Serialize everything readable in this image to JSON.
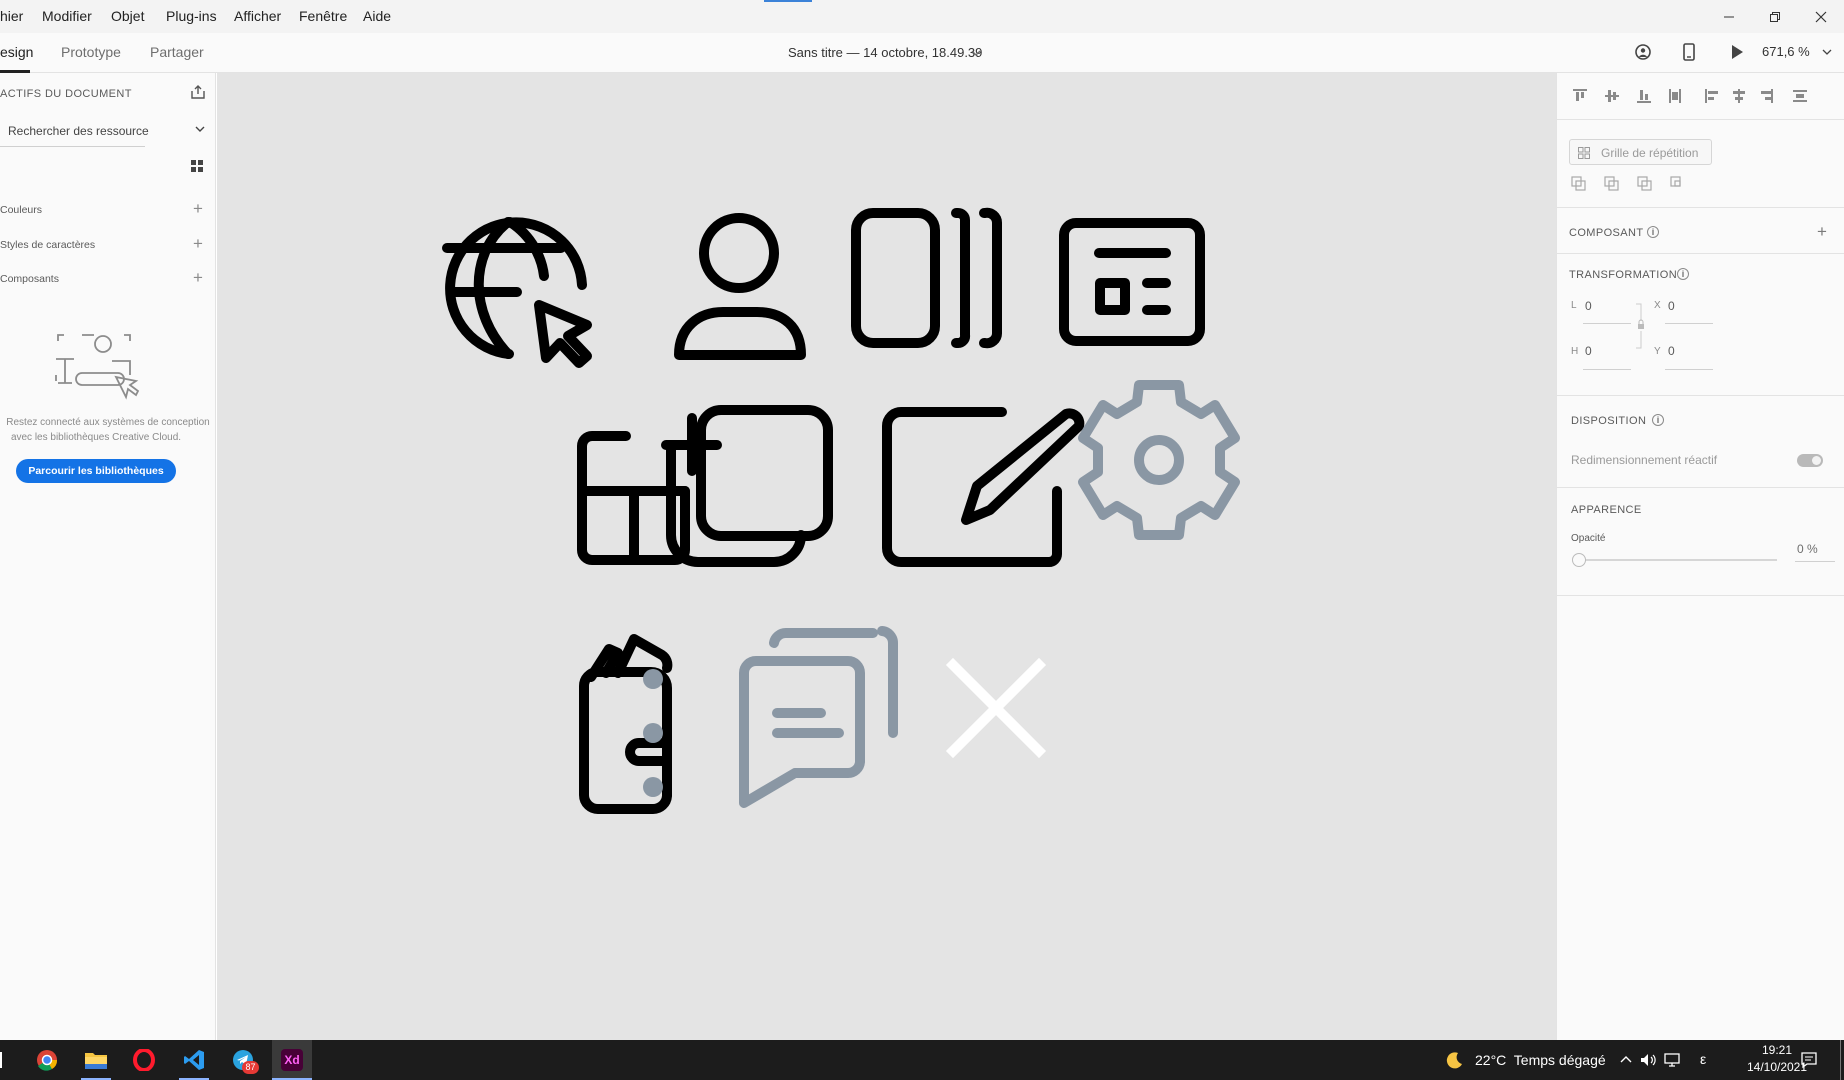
{
  "menubar": {
    "items": [
      "hier",
      "Modifier",
      "Objet",
      "Plug-ins",
      "Afficher",
      "Fenêtre",
      "Aide"
    ]
  },
  "toolbar": {
    "tabs": [
      "esign",
      "Prototype",
      "Partager"
    ],
    "document_title": "Sans titre — 14 octobre, 18.49.39",
    "zoom": "671,6 %"
  },
  "left_panel": {
    "header": "ACTIFS DU DOCUMENT",
    "search_value": "Rechercher des ressource",
    "sections": [
      "Couleurs",
      "Styles de caractères",
      "Composants"
    ],
    "empty_message_line1": "Restez connecté aux systèmes de conception",
    "empty_message_line2": "avec les bibliothèques Creative Cloud.",
    "browse_button": "Parcourir les bibliothèques"
  },
  "right_panel": {
    "repeat_grid": "Grille de répétition",
    "component": "COMPOSANT",
    "transform": "TRANSFORMATION",
    "l_label": "L",
    "l_value": "0",
    "x_label": "X",
    "x_value": "0",
    "h_label": "H",
    "h_value": "0",
    "y_label": "Y",
    "y_value": "0",
    "layout": "DISPOSITION",
    "responsive_resize": "Redimensionnement réactif",
    "appearance": "APPARENCE",
    "opacity_label": "Opacité",
    "opacity_value": "0 %"
  },
  "canvas": {
    "icons": [
      "globe-cursor-icon",
      "user-icon",
      "carousel-icon",
      "news-icon",
      "add-widget-icon",
      "copy-icon",
      "edit-icon",
      "settings-icon",
      "wallet-icon",
      "more-vertical-icon",
      "chat-multiple-icon",
      "dismiss-icon"
    ],
    "colors": {
      "black": "#000000",
      "gray": "#8a97a4",
      "white": "#ffffff"
    }
  },
  "taskbar": {
    "apps": [
      "chrome-icon",
      "file-explorer-icon",
      "opera-icon",
      "vscode-icon",
      "telegram-icon",
      "adobe-xd-icon"
    ],
    "telegram_badge": "87",
    "xd_label": "Xd",
    "weather": "22°C  Temps dégagé",
    "input_indicator": "ε",
    "time": "19:21",
    "date": "14/10/2021"
  }
}
